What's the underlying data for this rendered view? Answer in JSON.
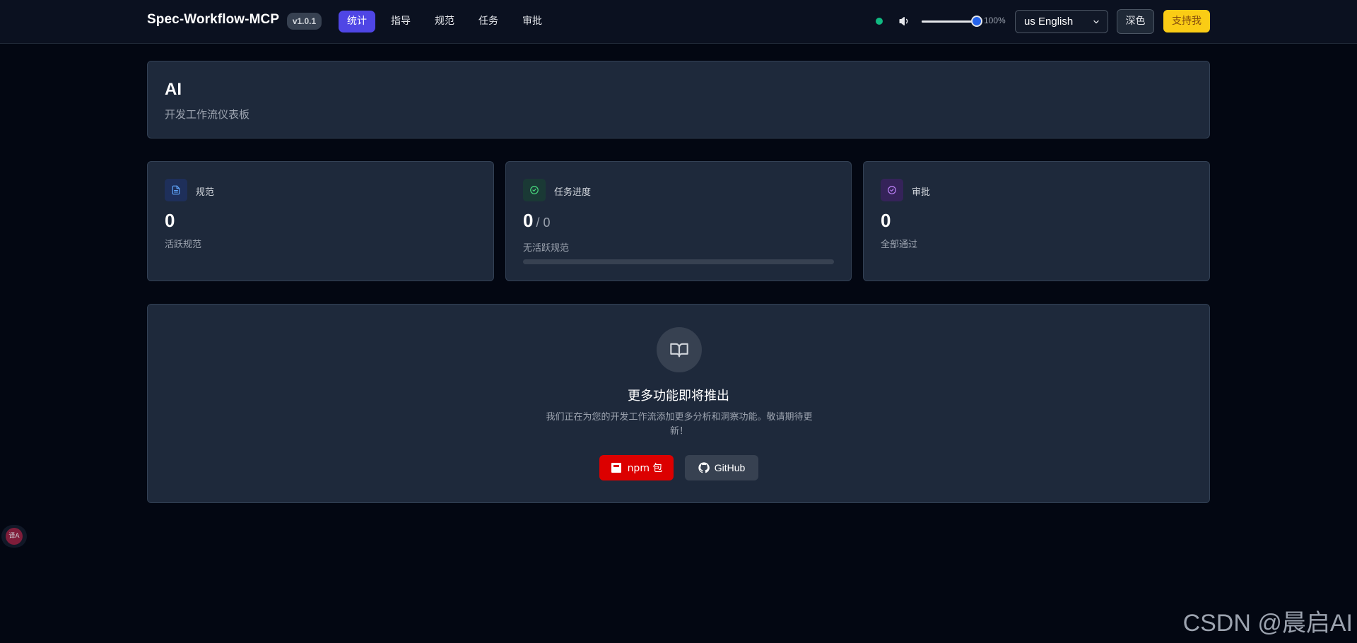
{
  "header": {
    "brand": "Spec-Workflow-MCP",
    "version": "v1.0.1",
    "nav": [
      {
        "label": "统计",
        "active": true
      },
      {
        "label": "指导",
        "active": false
      },
      {
        "label": "规范",
        "active": false
      },
      {
        "label": "任务",
        "active": false
      },
      {
        "label": "审批",
        "active": false
      }
    ],
    "connection_status_color": "#10b981",
    "volume_level": 1.0,
    "zoom_label": "100%",
    "language_selected": "us English",
    "theme_button": "深色",
    "support_button": "支持我"
  },
  "hero": {
    "title": "AI",
    "subtitle": "开发工作流仪表板"
  },
  "stats": {
    "specs": {
      "label": "规范",
      "value": "0",
      "desc": "活跃规范",
      "icon": "document-icon"
    },
    "tasks": {
      "label": "任务进度",
      "value": "0",
      "total": "/ 0",
      "desc": "无活跃规范",
      "progress": 0,
      "icon": "check-circle-icon"
    },
    "approvals": {
      "label": "审批",
      "value": "0",
      "desc": "全部通过",
      "icon": "check-circle-icon"
    }
  },
  "coming_soon": {
    "icon": "book-icon",
    "title": "更多功能即将推出",
    "description": "我们正在为您的开发工作流添加更多分析和洞察功能。敬请期待更新！",
    "npm_button": "npm 包",
    "github_button": "GitHub"
  },
  "translate_fab": "译A",
  "watermark": "CSDN @晨启AI"
}
